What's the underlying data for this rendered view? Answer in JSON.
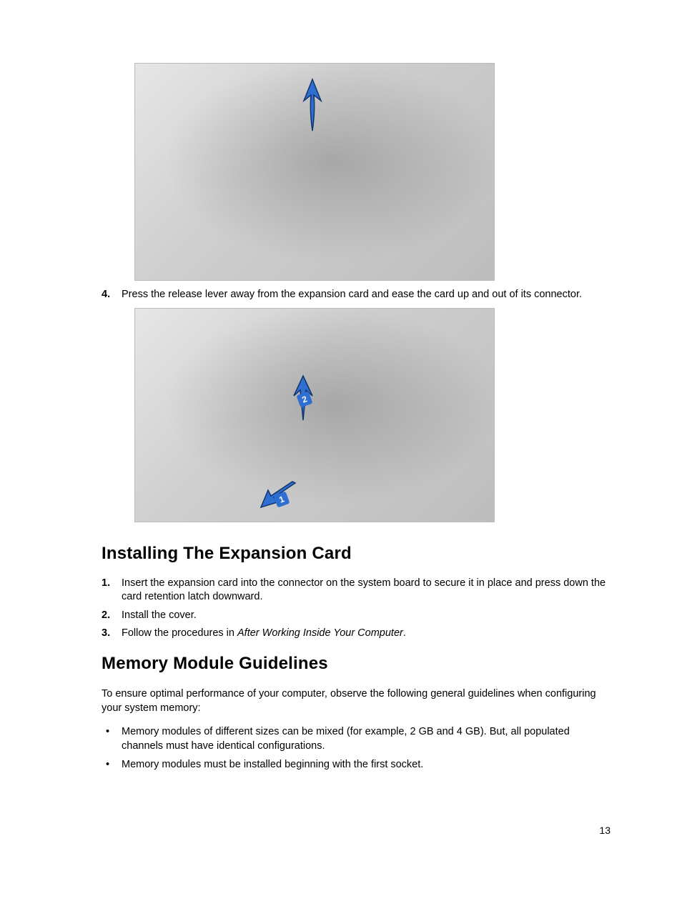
{
  "page_number": "13",
  "step4": {
    "num": "4.",
    "text": "Press the release lever away from the expansion card and ease the card up and out of its connector."
  },
  "section_install": {
    "heading": "Installing The Expansion Card",
    "steps": [
      {
        "num": "1.",
        "text": "Insert the expansion card into the connector on the system board to secure it in place and press down the card retention latch downward."
      },
      {
        "num": "2.",
        "text": "Install the cover."
      },
      {
        "num": "3.",
        "text_prefix": "Follow the procedures in ",
        "text_italic": "After Working Inside Your Computer",
        "text_suffix": "."
      }
    ]
  },
  "section_memory": {
    "heading": "Memory Module Guidelines",
    "intro": "To ensure optimal performance of your computer, observe the following general guidelines when configuring your system memory:",
    "bullets": [
      "Memory modules of different sizes can be mixed (for example, 2 GB and 4 GB). But, all populated channels must have identical configurations.",
      "Memory modules must be installed beginning with the first socket."
    ]
  },
  "figures": {
    "fig1_alt": "Computer interior showing expansion card being unlatched with upward arrow",
    "fig2_alt": "Computer interior showing expansion card lifted out with callouts 1 and 2",
    "callout1": "1",
    "callout2": "2"
  }
}
